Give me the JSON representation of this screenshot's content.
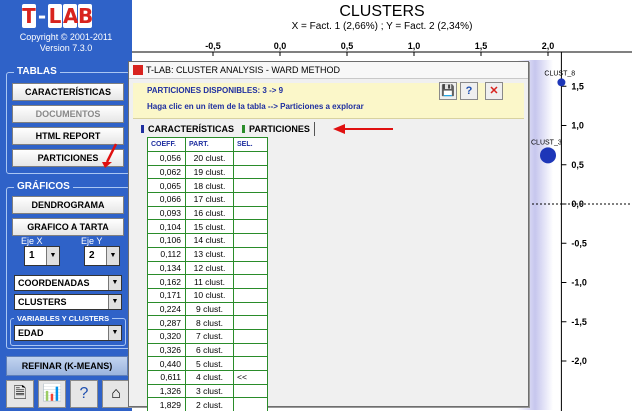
{
  "logo": {
    "letters": [
      "T",
      "-",
      "L",
      "A",
      "B"
    ]
  },
  "copyright": {
    "line1": "Copyright © 2001-2011",
    "line2": "Version 7.3.0"
  },
  "tablas": {
    "title": "TABLAS",
    "buttons": [
      "CARACTERÍSTICAS",
      "DOCUMENTOS",
      "HTML REPORT",
      "PARTICIONES"
    ]
  },
  "graficos": {
    "title": "GRÁFICOS",
    "buttons": [
      "DENDROGRAMA",
      "GRAFICO A TARTA"
    ],
    "eje_x_label": "Eje X",
    "eje_x_value": "1",
    "eje_y_label": "Eje Y",
    "eje_y_value": "2",
    "combo1": "COORDENADAS",
    "combo2": "CLUSTERS",
    "vars_title": "VARIABLES Y CLUSTERS",
    "combo3": "EDAD"
  },
  "refinar": "REFINAR (K-MEANS)",
  "bottom_icons": [
    "document-icon",
    "chart-icon",
    "help-icon",
    "home-icon"
  ],
  "chart": {
    "title": "CLUSTERS",
    "subtitle": "X = Fact. 1 (2,66%) ; Y = Fact. 2 (2,34%)"
  },
  "chart_data": {
    "type": "scatter",
    "title": "CLUSTERS",
    "subtitle": "X = Fact. 1 (2,66%) ; Y = Fact. 2 (2,34%)",
    "x_ticks": [
      "-0,5",
      "0,0",
      "0,5",
      "1,0",
      "1,5",
      "2,0"
    ],
    "y_ticks": [
      "1,5",
      "1,0",
      "0,5",
      "0,0",
      "-0,5",
      "-1,0",
      "-1,5",
      "-2,0"
    ],
    "xlim": [
      -1.0,
      2.2
    ],
    "ylim": [
      -2.1,
      1.7
    ],
    "points": [
      {
        "label": "CLUST_8",
        "x": 2.1,
        "y": 1.55
      },
      {
        "label": "CLUST_3",
        "x": 2.0,
        "y": 0.62
      }
    ]
  },
  "dialog": {
    "title": "T-LAB: CLUSTER ANALYSIS - WARD METHOD",
    "info1": "PARTICIONES DISPONIBLES: 3 -> 9",
    "info2": "Haga clic en un ítem de la tabla --> Particiones a explorar",
    "tab1": "CARACTERÍSTICAS",
    "tab2": "PARTICIONES",
    "colors": {
      "tab1": "#1f2fa0",
      "tab2": "#2a8c2a",
      "arrow": "#e01010"
    },
    "table": {
      "headers": [
        "COEFF.",
        "PART.",
        "SEL."
      ],
      "rows": [
        [
          "0,056",
          "20 clust.",
          ""
        ],
        [
          "0,062",
          "19 clust.",
          ""
        ],
        [
          "0,065",
          "18 clust.",
          ""
        ],
        [
          "0,066",
          "17 clust.",
          ""
        ],
        [
          "0,093",
          "16 clust.",
          ""
        ],
        [
          "0,104",
          "15 clust.",
          ""
        ],
        [
          "0,106",
          "14 clust.",
          ""
        ],
        [
          "0,112",
          "13 clust.",
          ""
        ],
        [
          "0,134",
          "12 clust.",
          ""
        ],
        [
          "0,162",
          "11 clust.",
          ""
        ],
        [
          "0,171",
          "10 clust.",
          ""
        ],
        [
          "0,224",
          "9 clust.",
          ""
        ],
        [
          "0,287",
          "8 clust.",
          ""
        ],
        [
          "0,320",
          "7 clust.",
          ""
        ],
        [
          "0,326",
          "6 clust.",
          ""
        ],
        [
          "0,440",
          "5 clust.",
          ""
        ],
        [
          "0,611",
          "4 clust.",
          "<<"
        ],
        [
          "1,326",
          "3 clust.",
          ""
        ],
        [
          "1,829",
          "2 clust.",
          ""
        ]
      ]
    }
  }
}
